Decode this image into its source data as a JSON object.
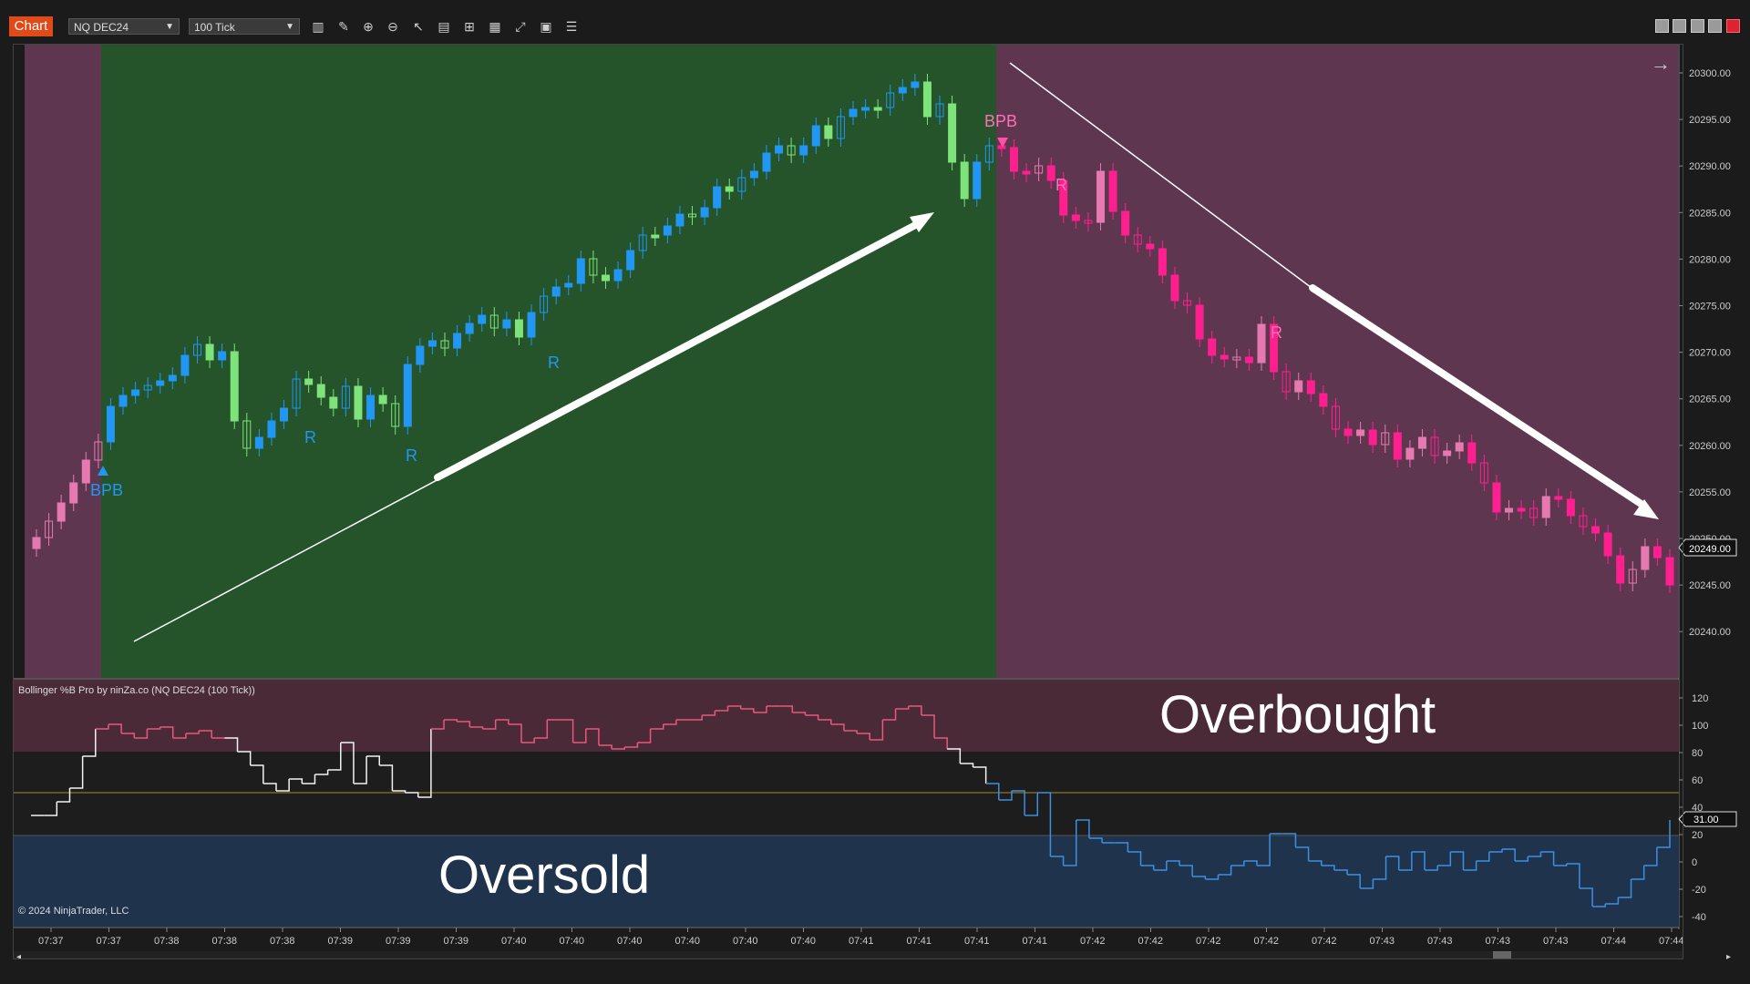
{
  "toolbar": {
    "chart_tab": "Chart",
    "instrument": "NQ DEC24",
    "interval": "100 Tick"
  },
  "price_panel": {
    "y_ticks": [
      "20300.00",
      "20295.00",
      "20290.00",
      "20285.00",
      "20280.00",
      "20275.00",
      "20270.00",
      "20265.00",
      "20260.00",
      "20255.00",
      "20250.00",
      "20245.00",
      "20240.00"
    ],
    "current_price": "20249.00",
    "signals": {
      "bpb_up": "BPB",
      "bpb_down": "BPB",
      "r_labels": [
        "R",
        "R",
        "R",
        "R",
        "R"
      ]
    },
    "colors": {
      "bull": "#2196f3",
      "bull_light": "#7de37a",
      "bear": "#ff1f8f",
      "bear_light": "#e67ab0",
      "bg_bull": "#25532a",
      "bg_bear": "#5f3650"
    }
  },
  "indicator_panel": {
    "title": "Bollinger %B Pro by ninZa.co (NQ DEC24 (100 Tick))",
    "y_ticks": [
      "120",
      "100",
      "80",
      "60",
      "40",
      "20",
      "0",
      "-20",
      "-40"
    ],
    "current_value": "31.00",
    "overbought_label": "Overbought",
    "oversold_label": "Oversold",
    "copyright": "© 2024 NinjaTrader, LLC"
  },
  "time_axis": {
    "labels": [
      "07:37",
      "07:37",
      "07:38",
      "07:38",
      "07:38",
      "07:39",
      "07:39",
      "07:39",
      "07:40",
      "07:40",
      "07:40",
      "07:40",
      "07:40",
      "07:40",
      "07:41",
      "07:41",
      "07:41",
      "07:41",
      "07:42",
      "07:42",
      "07:42",
      "07:42",
      "07:42",
      "07:43",
      "07:43",
      "07:43",
      "07:43",
      "07:44",
      "07:44"
    ]
  }
}
